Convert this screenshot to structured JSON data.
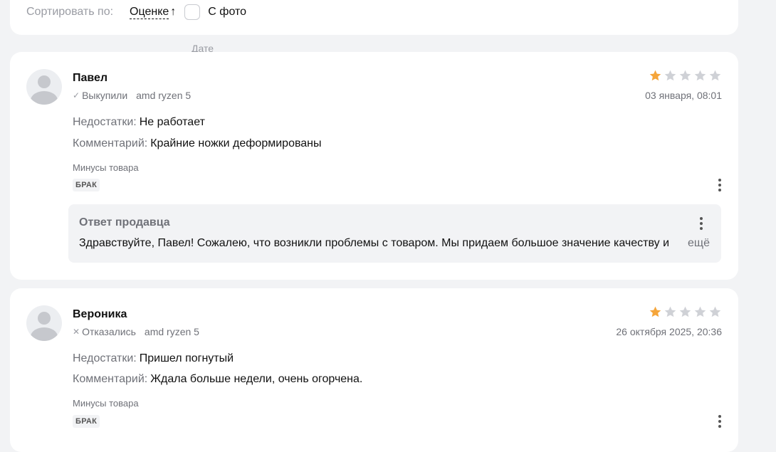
{
  "sort": {
    "label": "Сортировать по:",
    "options": [
      "Дате",
      "Оценке"
    ],
    "active_arrow": "↑",
    "photo_label": "С фото",
    "photo_checked": false
  },
  "colors": {
    "star_filled": "#f5a53a",
    "star_empty": "#cfd1d6"
  },
  "reviews": [
    {
      "author": "Павел",
      "status_icon": "check-icon",
      "status_symbol": "✓",
      "status": "Выкупили",
      "variant": "amd ryzen 5",
      "rating": 1,
      "max_rating": 5,
      "date": "03 января, 08:01",
      "cons_label": "Недостатки:",
      "cons": "Не работает",
      "comment_label": "Комментарий:",
      "comment": "Крайние ножки деформированы",
      "minus_title": "Минусы товара",
      "tag": "БРАК",
      "seller_reply": {
        "title": "Ответ продавца",
        "text": "Здравствуйте, Павел! Сожалею, что возникли проблемы с товаром. Мы придаем большое значение качеству и",
        "more": "ещё"
      }
    },
    {
      "author": "Вероника",
      "status_icon": "cross-icon",
      "status_symbol": "✕",
      "status": "Отказались",
      "variant": "amd ryzen 5",
      "rating": 1,
      "max_rating": 5,
      "date": "26 октября 2025, 20:36",
      "cons_label": "Недостатки:",
      "cons": "Пришел погнутый",
      "comment_label": "Комментарий:",
      "comment": "Ждала больше недели, очень огорчена.",
      "minus_title": "Минусы товара",
      "tag": "БРАК"
    }
  ]
}
